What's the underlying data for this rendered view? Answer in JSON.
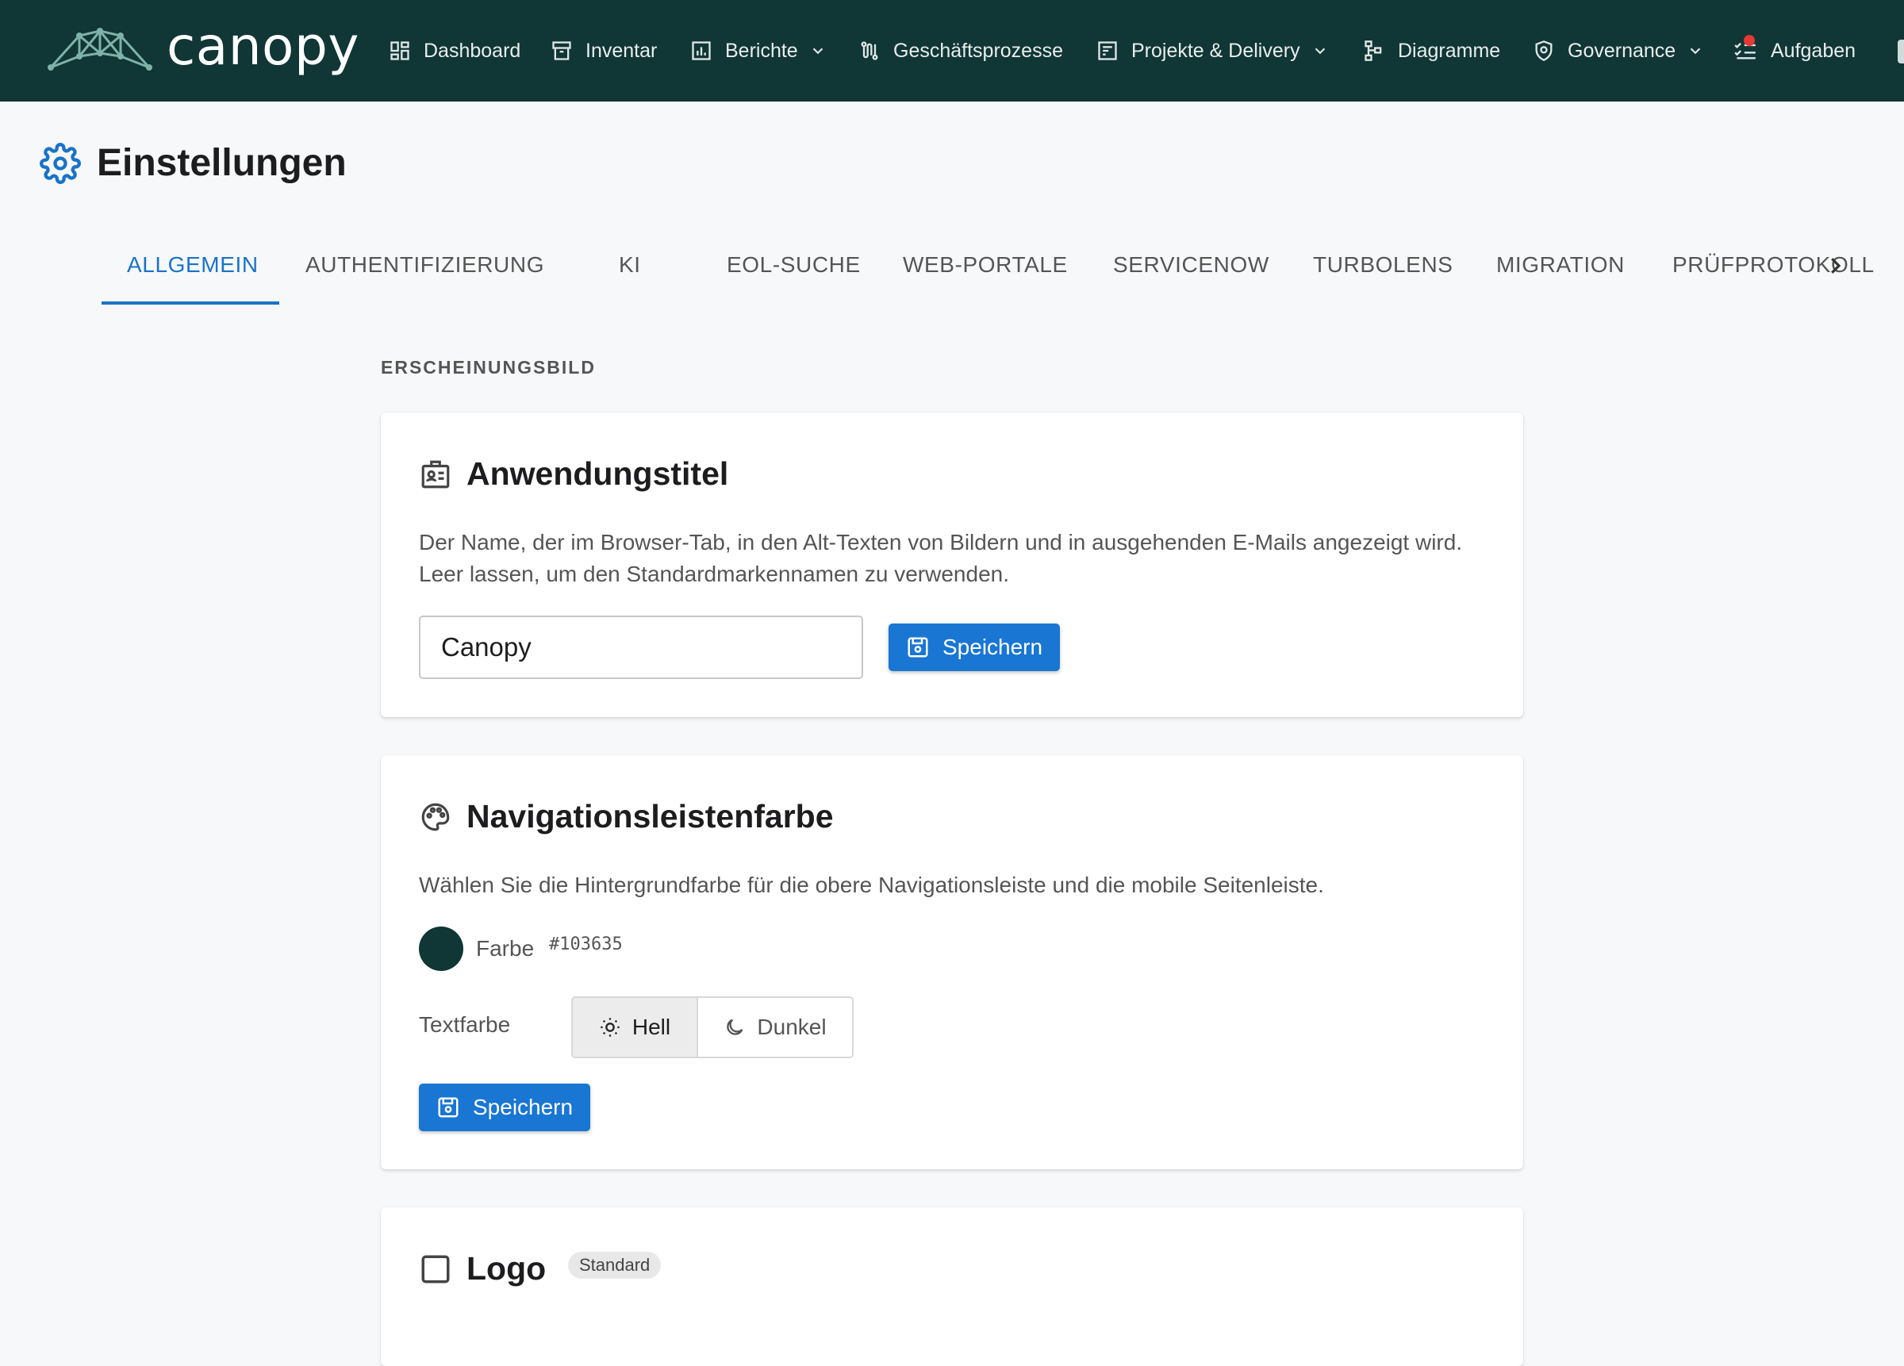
{
  "brand": {
    "name": "canopy",
    "navbar_color": "#103635",
    "accent": "#1a73c7"
  },
  "nav": {
    "items": [
      {
        "label": "Dashboard"
      },
      {
        "label": "Inventar"
      },
      {
        "label": "Berichte"
      },
      {
        "label": "Geschäftsprozesse"
      },
      {
        "label": "Projekte & Delivery"
      },
      {
        "label": "Diagramme"
      },
      {
        "label": "Governance"
      },
      {
        "label": "Aufgaben"
      }
    ]
  },
  "page": {
    "title": "Einstellungen"
  },
  "tabs": [
    {
      "label": "ALLGEMEIN",
      "active": true
    },
    {
      "label": "AUTHENTIFIZIERUNG"
    },
    {
      "label": "KI"
    },
    {
      "label": "EOL-SUCHE"
    },
    {
      "label": "WEB-PORTALE"
    },
    {
      "label": "SERVICENOW"
    },
    {
      "label": "TURBOLENS"
    },
    {
      "label": "MIGRATION"
    },
    {
      "label": "PRÜFPROTOKOLL"
    }
  ],
  "section": {
    "label": "ERSCHEINUNGSBILD"
  },
  "app_title_card": {
    "title": "Anwendungstitel",
    "description": "Der Name, der im Browser-Tab, in den Alt-Texten von Bildern und in ausgehenden E-Mails angezeigt wird. Leer lassen, um den Standardmarkennamen zu verwenden.",
    "input_value": "Canopy",
    "save_label": "Speichern"
  },
  "navbar_color_card": {
    "title": "Navigationsleistenfarbe",
    "description": "Wählen Sie die Hintergrundfarbe für die obere Navigationsleiste und die mobile Seitenleiste.",
    "color_label": "Farbe",
    "color_value": "#103635",
    "text_color_label": "Textfarbe",
    "light_label": "Hell",
    "dark_label": "Dunkel",
    "selected_text_color": "Hell",
    "save_label": "Speichern"
  },
  "logo_card": {
    "title": "Logo",
    "badge": "Standard"
  }
}
